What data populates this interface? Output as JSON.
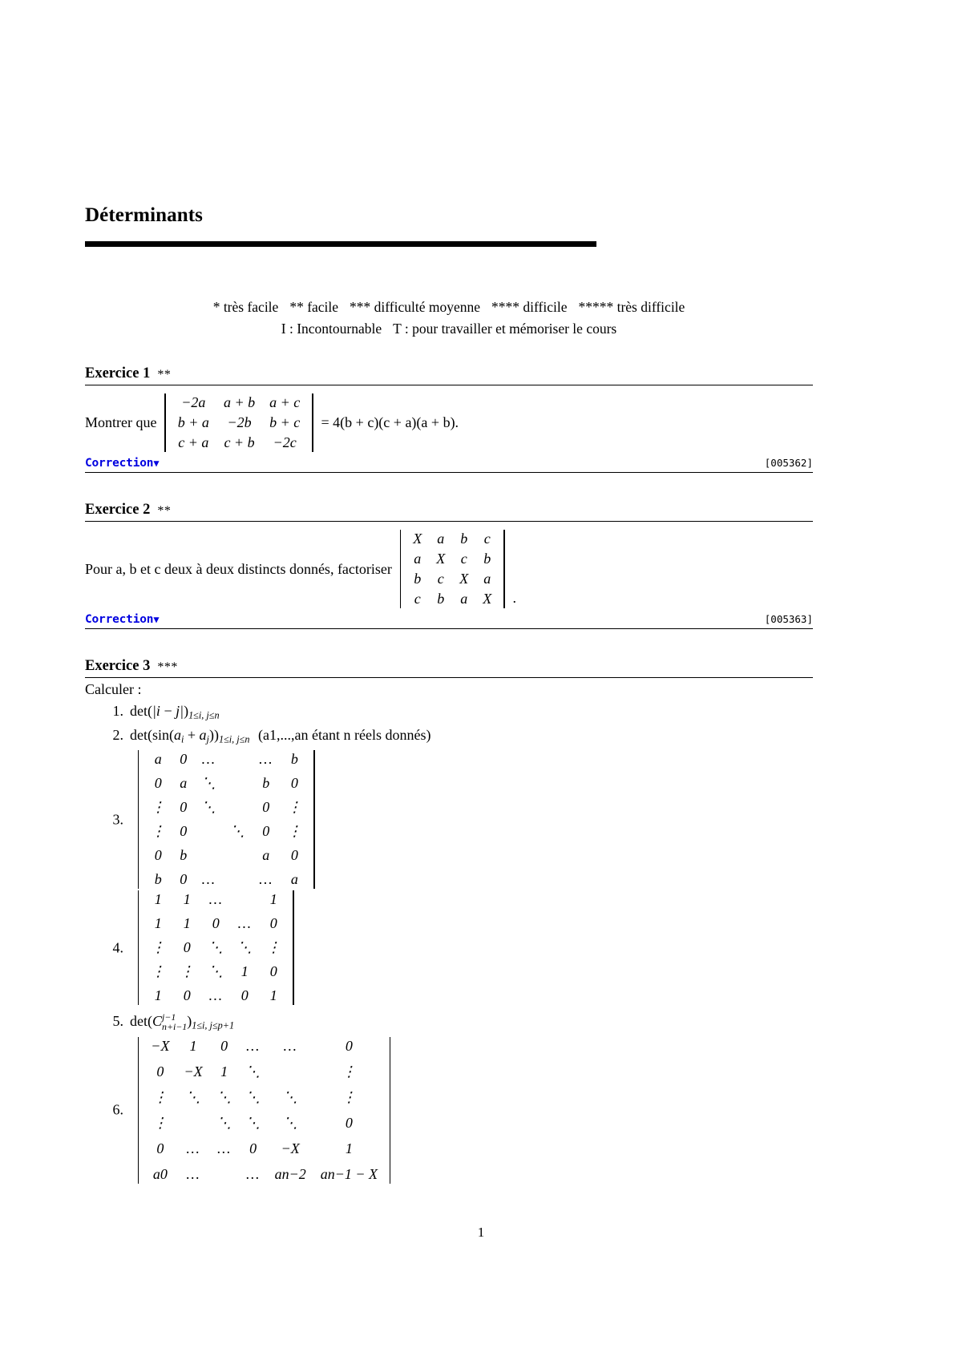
{
  "document": {
    "title": "Déterminants",
    "page_number": "1"
  },
  "legend": {
    "line1": [
      "* très facile",
      "** facile",
      "*** difficulté moyenne",
      "**** difficile",
      "***** très difficile"
    ],
    "line2": [
      "I : Incontournable",
      "T : pour travailler et mémoriser le cours"
    ]
  },
  "correction_label": "Correction",
  "correction_caret": "▼",
  "exercises": [
    {
      "title": "Exercice 1",
      "stars": "**",
      "lead": "Montrer que",
      "matrix": [
        [
          "−2a",
          "a + b",
          "a + c"
        ],
        [
          "b + a",
          "−2b",
          "b + c"
        ],
        [
          "c + a",
          "c + b",
          "−2c"
        ]
      ],
      "tail": "= 4(b + c)(c + a)(a + b).",
      "id": "[005362]"
    },
    {
      "title": "Exercice 2",
      "stars": "**",
      "lead": "Pour a, b et c deux à deux distincts donnés, factoriser",
      "matrix": [
        [
          "X",
          "a",
          "b",
          "c"
        ],
        [
          "a",
          "X",
          "c",
          "b"
        ],
        [
          "b",
          "c",
          "X",
          "a"
        ],
        [
          "c",
          "b",
          "a",
          "X"
        ]
      ],
      "tail": ".",
      "id": "[005363]"
    },
    {
      "title": "Exercice 3",
      "stars": "***",
      "lead": "Calculer :",
      "items": [
        {
          "num": "1.",
          "kind": "formula",
          "text": "det(|i − j|)",
          "condition": "1≤i, j≤n"
        },
        {
          "num": "2.",
          "kind": "formula",
          "text": "det(sin(a_i + a_j))",
          "condition": "1≤i, j≤n",
          "note": "(a1,...,an étant n réels donnés)"
        },
        {
          "num": "3.",
          "kind": "matrix",
          "matrix": [
            [
              "a",
              "0",
              "…",
              "",
              "…",
              "b"
            ],
            [
              "0",
              "a",
              "⋱",
              "",
              "b",
              "0"
            ],
            [
              "⋮",
              "0",
              "⋱",
              "",
              "0",
              "⋮"
            ],
            [
              "⋮",
              "0",
              "",
              "⋱",
              "0",
              "⋮"
            ],
            [
              "0",
              "b",
              "",
              "",
              "a",
              "0"
            ],
            [
              "b",
              "0",
              "…",
              "",
              "…",
              "a"
            ]
          ]
        },
        {
          "num": "4.",
          "kind": "matrix",
          "matrix": [
            [
              "1",
              "1",
              "…",
              "",
              "1"
            ],
            [
              "1",
              "1",
              "0",
              "…",
              "0"
            ],
            [
              "⋮",
              "0",
              "⋱",
              "⋱",
              "⋮"
            ],
            [
              "⋮",
              "⋮",
              "⋱",
              "1",
              "0"
            ],
            [
              "1",
              "0",
              "…",
              "0",
              "1"
            ]
          ]
        },
        {
          "num": "5.",
          "kind": "formula",
          "text": "det(C)",
          "binom_lower": "n+i−1",
          "binom_upper": "j−1",
          "condition": "1≤i, j≤p+1"
        },
        {
          "num": "6.",
          "kind": "matrix",
          "matrix": [
            [
              "−X",
              "1",
              "0",
              "…",
              "…",
              "0"
            ],
            [
              "0",
              "−X",
              "1",
              "⋱",
              "",
              "⋮"
            ],
            [
              "⋮",
              "⋱",
              "⋱",
              "⋱",
              "⋱",
              "⋮"
            ],
            [
              "⋮",
              "",
              "⋱",
              "⋱",
              "⋱",
              "0"
            ],
            [
              "0",
              "…",
              "…",
              "0",
              "−X",
              "1"
            ],
            [
              "a0",
              "…",
              "",
              "…",
              "an−2",
              "an−1 − X"
            ]
          ]
        }
      ]
    }
  ]
}
